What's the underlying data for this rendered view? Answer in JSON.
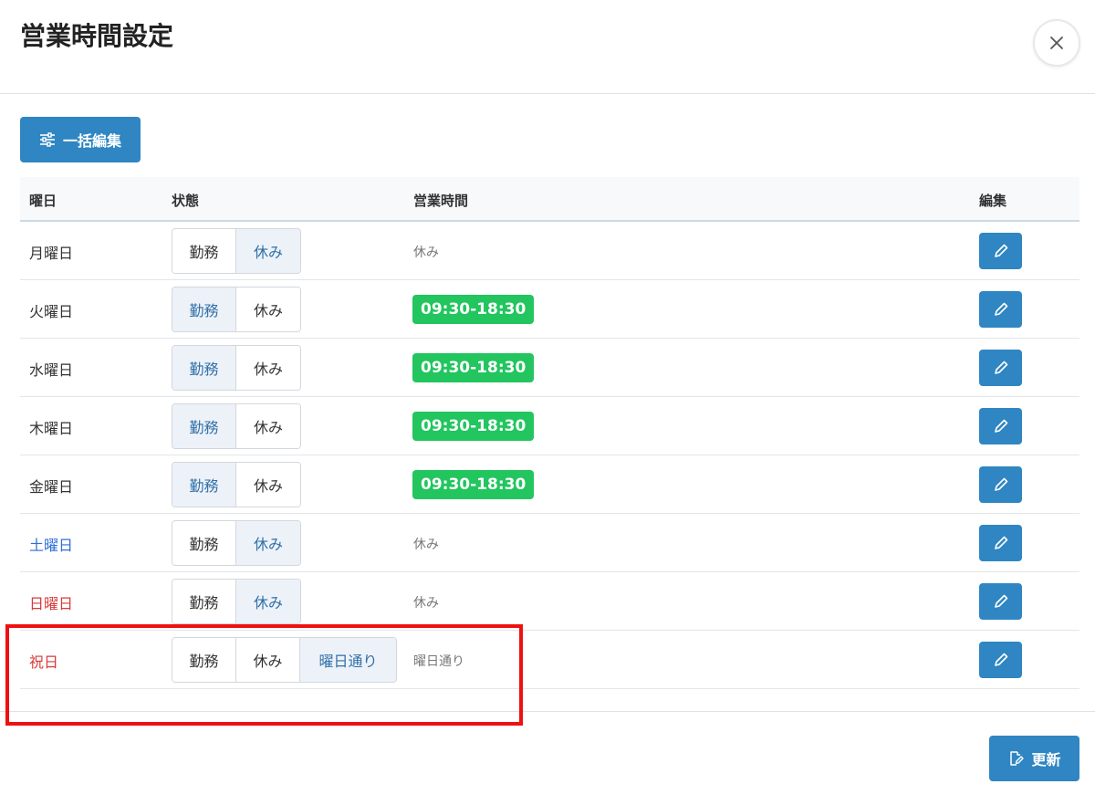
{
  "modal": {
    "title": "営業時間設定",
    "bulk_edit_label": "一括編集",
    "update_label": "更新"
  },
  "table": {
    "headers": {
      "day": "曜日",
      "status": "状態",
      "hours": "営業時間",
      "edit": "編集"
    },
    "option_work": "勤務",
    "option_off": "休み",
    "option_same_as_weekday": "曜日通り",
    "rows": [
      {
        "day": "月曜日",
        "status": "休み",
        "hours": "休み"
      },
      {
        "day": "火曜日",
        "status": "勤務",
        "hours": "09:30-18:30"
      },
      {
        "day": "水曜日",
        "status": "勤務",
        "hours": "09:30-18:30"
      },
      {
        "day": "木曜日",
        "status": "勤務",
        "hours": "09:30-18:30"
      },
      {
        "day": "金曜日",
        "status": "勤務",
        "hours": "09:30-18:30"
      },
      {
        "day": "土曜日",
        "status": "休み",
        "hours": "休み"
      },
      {
        "day": "日曜日",
        "status": "休み",
        "hours": "休み"
      },
      {
        "day": "祝日",
        "status": "曜日通り",
        "hours": "曜日通り"
      }
    ]
  },
  "colors": {
    "primary": "#2f86c2",
    "hours_badge": "#22c55e",
    "saturday": "#2f6fd6",
    "sunday_holiday": "#d83a3a",
    "highlight_box": "#ee1111"
  },
  "icons": {
    "close": "close-icon",
    "bulk_edit": "sliders-icon",
    "edit": "pencil-icon",
    "update": "edit-document-icon"
  }
}
